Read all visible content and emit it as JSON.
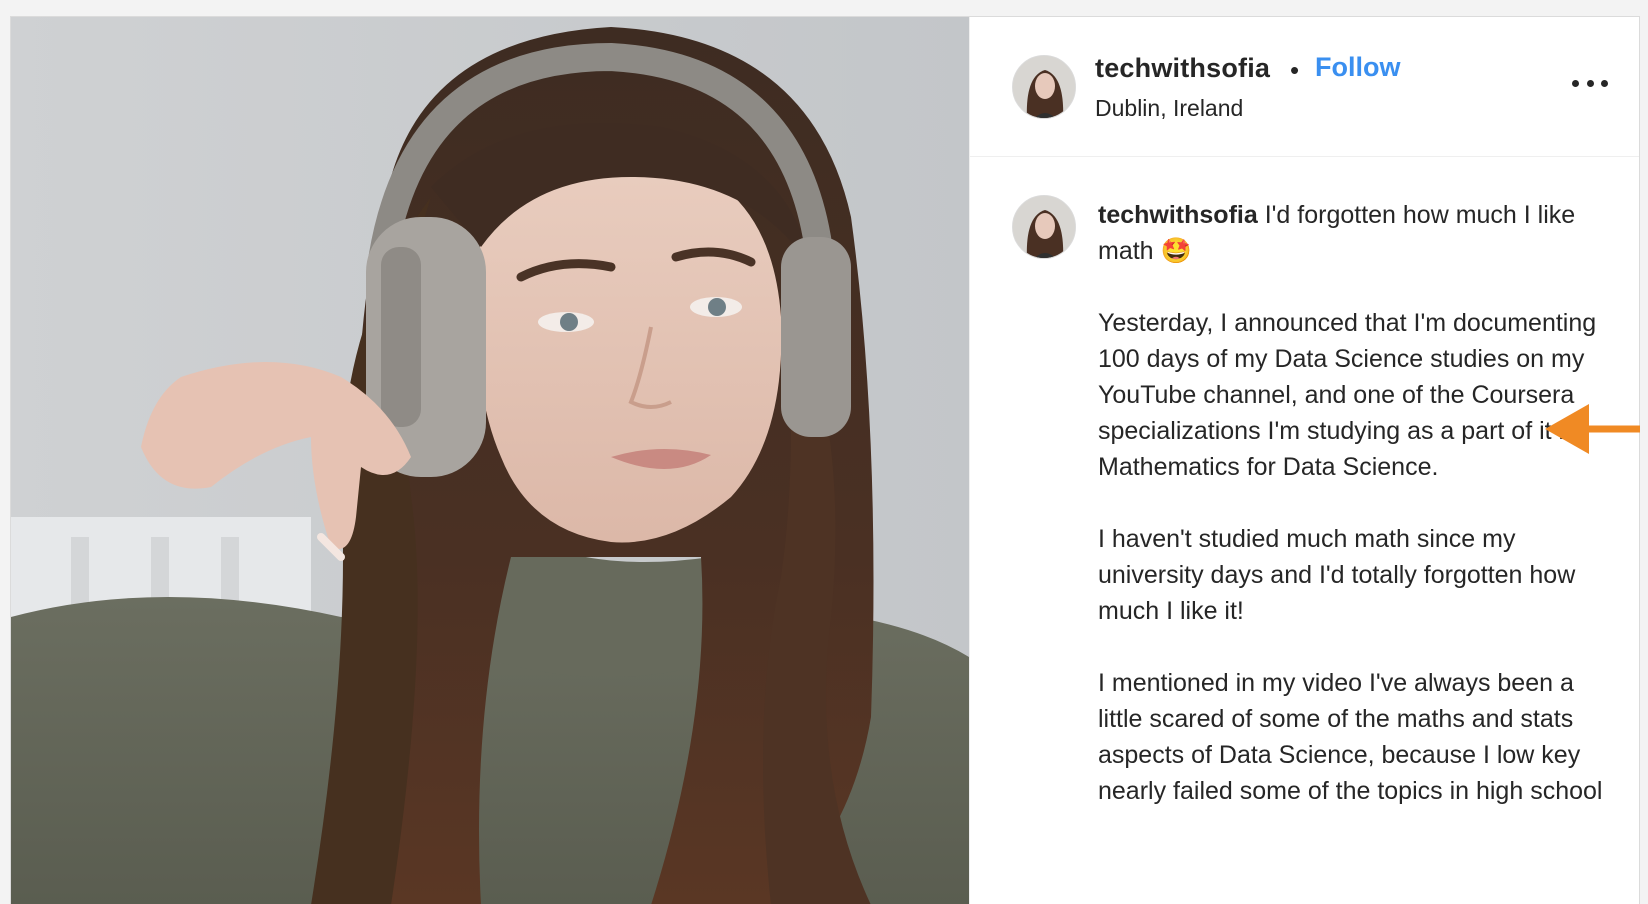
{
  "post": {
    "username": "techwithsofia",
    "separator": "•",
    "follow_label": "Follow",
    "location": "Dublin, Ireland",
    "more_icon": "more-horizontal-icon"
  },
  "caption": {
    "username": "techwithsofia",
    "first_line": "I'd forgotten how much I like math 🤩",
    "paragraphs": [
      "Yesterday, I announced that I'm documenting 100 days of my Data Science studies on my YouTube channel, and one of the Coursera specializations I'm studying as a part of it is Mathematics for Data Science.",
      "I haven't studied much math since my university days and I'd totally forgotten how much I like it!",
      "I mentioned in my video I've always been a little scared of some of the maths and stats aspects of Data Science, because I low key nearly failed some of the topics in high school"
    ]
  },
  "colors": {
    "follow": "#3a8ff0",
    "arrow": "#f08a24",
    "text": "#262626"
  }
}
